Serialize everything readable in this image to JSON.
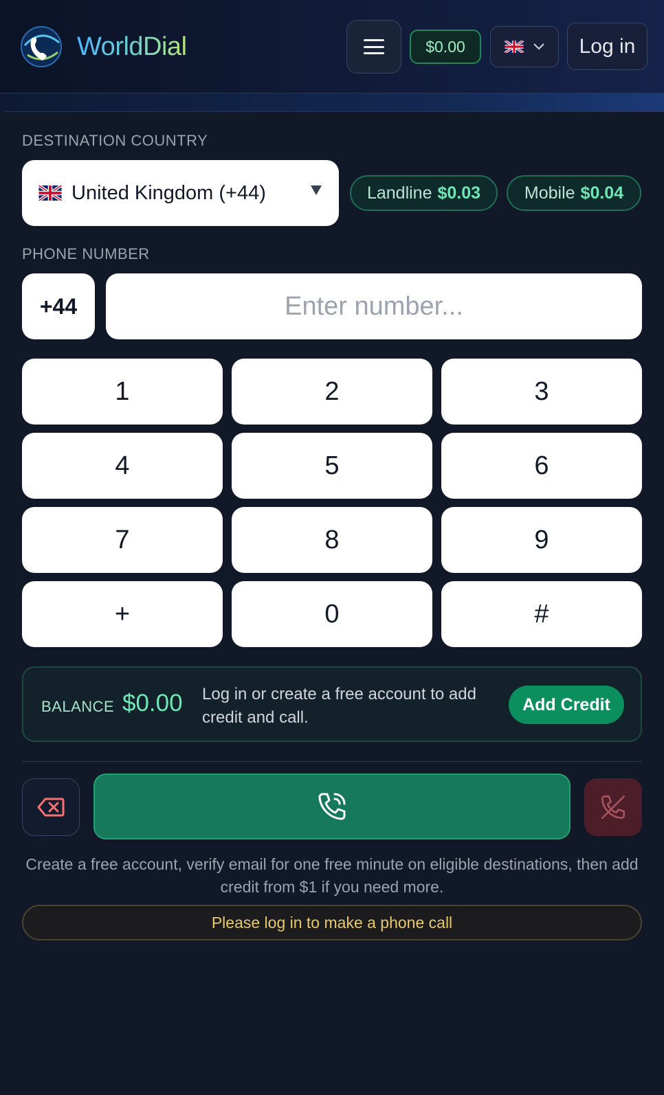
{
  "header": {
    "brand": "WorldDial",
    "balance": "$0.00",
    "login_label": "Log in"
  },
  "dialer": {
    "country_label": "DESTINATION COUNTRY",
    "country_value": "United Kingdom (+44)",
    "rates": [
      {
        "label": "Landline",
        "price": "$0.03"
      },
      {
        "label": "Mobile",
        "price": "$0.04"
      }
    ],
    "phone_label": "PHONE NUMBER",
    "prefix": "+44",
    "number_placeholder": "Enter number...",
    "number_value": "",
    "keys": [
      "1",
      "2",
      "3",
      "4",
      "5",
      "6",
      "7",
      "8",
      "9",
      "+",
      "0",
      "#"
    ]
  },
  "balance_box": {
    "label": "BALANCE",
    "value": "$0.00",
    "message": "Log in or create a free account to add credit and call.",
    "add_credit_label": "Add Credit"
  },
  "footer": {
    "info": "Create a free account, verify email for one free minute on eligible destinations, then add credit from $1 if you need more.",
    "warning": "Please log in to make a phone call"
  },
  "colors": {
    "accent_green": "#0b8f5f",
    "call_green": "#167a5a",
    "hangup_red": "#4b1e2a",
    "warning_text": "#e7c96a",
    "background": "#111827"
  },
  "icons": {
    "logo": "globe-phone-icon",
    "menu": "hamburger-menu-icon",
    "language": "uk-flag-icon",
    "backspace": "backspace-icon",
    "call": "phone-call-icon",
    "hangup": "phone-off-icon"
  }
}
